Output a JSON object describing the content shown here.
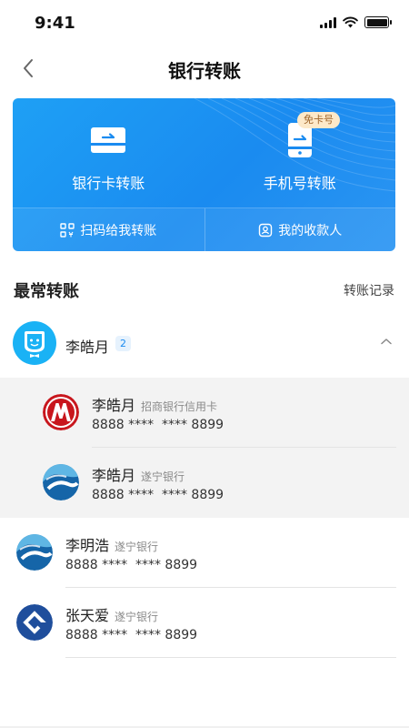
{
  "status": {
    "time": "9:41"
  },
  "nav": {
    "title": "银行转账"
  },
  "card": {
    "options": [
      {
        "label": "银行卡转账",
        "icon": "bank-card-icon"
      },
      {
        "label": "手机号转账",
        "icon": "phone-icon",
        "badge": "免卡号"
      }
    ],
    "sub_actions": [
      {
        "label": "扫码给我转账",
        "icon": "qr-code-icon"
      },
      {
        "label": "我的收款人",
        "icon": "contact-icon"
      }
    ]
  },
  "section": {
    "title": "最常转账",
    "history_label": "转账记录"
  },
  "group": {
    "name": "李皓月",
    "count": "2",
    "accounts": [
      {
        "name": "李皓月",
        "bank": "招商银行信用卡",
        "account": "8888 ****  **** 8899",
        "logo": "cmb-logo"
      },
      {
        "name": "李皓月",
        "bank": "遂宁银行",
        "account": "8888 ****  **** 8899",
        "logo": "suining-bank-logo"
      }
    ]
  },
  "contacts": [
    {
      "name": "李明浩",
      "bank": "遂宁银行",
      "account": "8888 ****  **** 8899",
      "logo": "suining-bank-logo"
    },
    {
      "name": "张天爱",
      "bank": "遂宁银行",
      "account": "8888 ****  **** 8899",
      "logo": "ccb-logo"
    }
  ],
  "colors": {
    "primary": "#1a8bf0",
    "avatar": "#1ab2f5",
    "cmb_red": "#c8161d",
    "ccb_blue": "#1f4e9c",
    "suining_blue": "#1565a8"
  }
}
